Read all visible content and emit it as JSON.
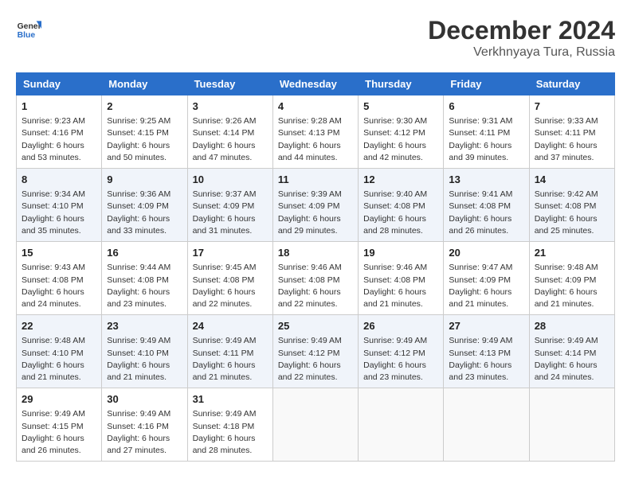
{
  "header": {
    "logo_line1": "General",
    "logo_line2": "Blue",
    "month": "December 2024",
    "location": "Verkhnyaya Tura, Russia"
  },
  "weekdays": [
    "Sunday",
    "Monday",
    "Tuesday",
    "Wednesday",
    "Thursday",
    "Friday",
    "Saturday"
  ],
  "weeks": [
    [
      {
        "day": "1",
        "sunrise": "Sunrise: 9:23 AM",
        "sunset": "Sunset: 4:16 PM",
        "daylight": "Daylight: 6 hours and 53 minutes."
      },
      {
        "day": "2",
        "sunrise": "Sunrise: 9:25 AM",
        "sunset": "Sunset: 4:15 PM",
        "daylight": "Daylight: 6 hours and 50 minutes."
      },
      {
        "day": "3",
        "sunrise": "Sunrise: 9:26 AM",
        "sunset": "Sunset: 4:14 PM",
        "daylight": "Daylight: 6 hours and 47 minutes."
      },
      {
        "day": "4",
        "sunrise": "Sunrise: 9:28 AM",
        "sunset": "Sunset: 4:13 PM",
        "daylight": "Daylight: 6 hours and 44 minutes."
      },
      {
        "day": "5",
        "sunrise": "Sunrise: 9:30 AM",
        "sunset": "Sunset: 4:12 PM",
        "daylight": "Daylight: 6 hours and 42 minutes."
      },
      {
        "day": "6",
        "sunrise": "Sunrise: 9:31 AM",
        "sunset": "Sunset: 4:11 PM",
        "daylight": "Daylight: 6 hours and 39 minutes."
      },
      {
        "day": "7",
        "sunrise": "Sunrise: 9:33 AM",
        "sunset": "Sunset: 4:11 PM",
        "daylight": "Daylight: 6 hours and 37 minutes."
      }
    ],
    [
      {
        "day": "8",
        "sunrise": "Sunrise: 9:34 AM",
        "sunset": "Sunset: 4:10 PM",
        "daylight": "Daylight: 6 hours and 35 minutes."
      },
      {
        "day": "9",
        "sunrise": "Sunrise: 9:36 AM",
        "sunset": "Sunset: 4:09 PM",
        "daylight": "Daylight: 6 hours and 33 minutes."
      },
      {
        "day": "10",
        "sunrise": "Sunrise: 9:37 AM",
        "sunset": "Sunset: 4:09 PM",
        "daylight": "Daylight: 6 hours and 31 minutes."
      },
      {
        "day": "11",
        "sunrise": "Sunrise: 9:39 AM",
        "sunset": "Sunset: 4:09 PM",
        "daylight": "Daylight: 6 hours and 29 minutes."
      },
      {
        "day": "12",
        "sunrise": "Sunrise: 9:40 AM",
        "sunset": "Sunset: 4:08 PM",
        "daylight": "Daylight: 6 hours and 28 minutes."
      },
      {
        "day": "13",
        "sunrise": "Sunrise: 9:41 AM",
        "sunset": "Sunset: 4:08 PM",
        "daylight": "Daylight: 6 hours and 26 minutes."
      },
      {
        "day": "14",
        "sunrise": "Sunrise: 9:42 AM",
        "sunset": "Sunset: 4:08 PM",
        "daylight": "Daylight: 6 hours and 25 minutes."
      }
    ],
    [
      {
        "day": "15",
        "sunrise": "Sunrise: 9:43 AM",
        "sunset": "Sunset: 4:08 PM",
        "daylight": "Daylight: 6 hours and 24 minutes."
      },
      {
        "day": "16",
        "sunrise": "Sunrise: 9:44 AM",
        "sunset": "Sunset: 4:08 PM",
        "daylight": "Daylight: 6 hours and 23 minutes."
      },
      {
        "day": "17",
        "sunrise": "Sunrise: 9:45 AM",
        "sunset": "Sunset: 4:08 PM",
        "daylight": "Daylight: 6 hours and 22 minutes."
      },
      {
        "day": "18",
        "sunrise": "Sunrise: 9:46 AM",
        "sunset": "Sunset: 4:08 PM",
        "daylight": "Daylight: 6 hours and 22 minutes."
      },
      {
        "day": "19",
        "sunrise": "Sunrise: 9:46 AM",
        "sunset": "Sunset: 4:08 PM",
        "daylight": "Daylight: 6 hours and 21 minutes."
      },
      {
        "day": "20",
        "sunrise": "Sunrise: 9:47 AM",
        "sunset": "Sunset: 4:09 PM",
        "daylight": "Daylight: 6 hours and 21 minutes."
      },
      {
        "day": "21",
        "sunrise": "Sunrise: 9:48 AM",
        "sunset": "Sunset: 4:09 PM",
        "daylight": "Daylight: 6 hours and 21 minutes."
      }
    ],
    [
      {
        "day": "22",
        "sunrise": "Sunrise: 9:48 AM",
        "sunset": "Sunset: 4:10 PM",
        "daylight": "Daylight: 6 hours and 21 minutes."
      },
      {
        "day": "23",
        "sunrise": "Sunrise: 9:49 AM",
        "sunset": "Sunset: 4:10 PM",
        "daylight": "Daylight: 6 hours and 21 minutes."
      },
      {
        "day": "24",
        "sunrise": "Sunrise: 9:49 AM",
        "sunset": "Sunset: 4:11 PM",
        "daylight": "Daylight: 6 hours and 21 minutes."
      },
      {
        "day": "25",
        "sunrise": "Sunrise: 9:49 AM",
        "sunset": "Sunset: 4:12 PM",
        "daylight": "Daylight: 6 hours and 22 minutes."
      },
      {
        "day": "26",
        "sunrise": "Sunrise: 9:49 AM",
        "sunset": "Sunset: 4:12 PM",
        "daylight": "Daylight: 6 hours and 23 minutes."
      },
      {
        "day": "27",
        "sunrise": "Sunrise: 9:49 AM",
        "sunset": "Sunset: 4:13 PM",
        "daylight": "Daylight: 6 hours and 23 minutes."
      },
      {
        "day": "28",
        "sunrise": "Sunrise: 9:49 AM",
        "sunset": "Sunset: 4:14 PM",
        "daylight": "Daylight: 6 hours and 24 minutes."
      }
    ],
    [
      {
        "day": "29",
        "sunrise": "Sunrise: 9:49 AM",
        "sunset": "Sunset: 4:15 PM",
        "daylight": "Daylight: 6 hours and 26 minutes."
      },
      {
        "day": "30",
        "sunrise": "Sunrise: 9:49 AM",
        "sunset": "Sunset: 4:16 PM",
        "daylight": "Daylight: 6 hours and 27 minutes."
      },
      {
        "day": "31",
        "sunrise": "Sunrise: 9:49 AM",
        "sunset": "Sunset: 4:18 PM",
        "daylight": "Daylight: 6 hours and 28 minutes."
      },
      null,
      null,
      null,
      null
    ]
  ]
}
